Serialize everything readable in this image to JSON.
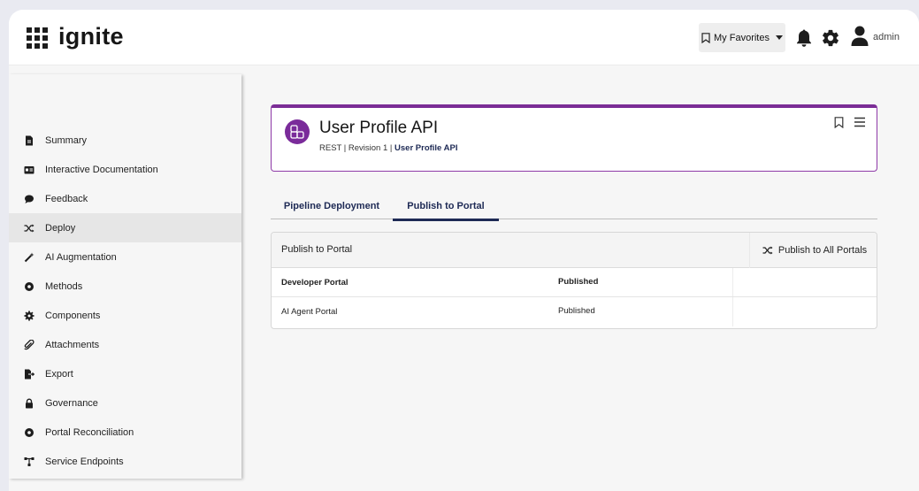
{
  "brand": {
    "name": "ignite"
  },
  "topbar": {
    "favorites_label": "My Favorites",
    "user_label": "admin"
  },
  "sidebar": {
    "items": [
      {
        "label": "Summary",
        "icon": "document-icon"
      },
      {
        "label": "Interactive Documentation",
        "icon": "id-card-icon"
      },
      {
        "label": "Feedback",
        "icon": "chat-bubble-icon"
      },
      {
        "label": "Deploy",
        "icon": "shuffle-icon",
        "active": true
      },
      {
        "label": "AI Augmentation",
        "icon": "magic-wand-icon"
      },
      {
        "label": "Methods",
        "icon": "circle-dot-icon"
      },
      {
        "label": "Components",
        "icon": "cog-small-icon"
      },
      {
        "label": "Attachments",
        "icon": "paperclip-icon"
      },
      {
        "label": "Export",
        "icon": "file-export-icon"
      },
      {
        "label": "Governance",
        "icon": "lock-icon"
      },
      {
        "label": "Portal Reconciliation",
        "icon": "circle-dot-icon"
      },
      {
        "label": "Service Endpoints",
        "icon": "network-icon"
      }
    ]
  },
  "header": {
    "title": "User Profile API",
    "subtitle_prefix": "REST | Revision 1 | ",
    "subtitle_link": "User Profile API"
  },
  "tabs": [
    {
      "label": "Pipeline Deployment"
    },
    {
      "label": "Publish to Portal",
      "active": true
    }
  ],
  "publish": {
    "title": "Publish to Portal",
    "publish_all_label": "Publish to All Portals",
    "rows": [
      {
        "portal": "Developer Portal",
        "status": "Published"
      },
      {
        "portal": "AI Agent Portal",
        "status": "Published"
      }
    ]
  },
  "colors": {
    "accent_purple": "#7b2d96",
    "navy": "#1e2a55",
    "background": "#f6f6f6"
  }
}
